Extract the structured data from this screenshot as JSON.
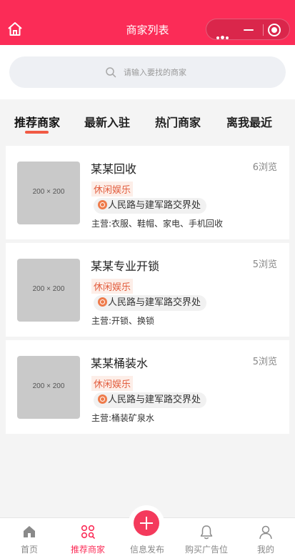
{
  "header": {
    "title": "商家列表",
    "home_icon": "home-icon",
    "capsule": {
      "more_icon": "more-dots-icon",
      "minimize_icon": "minimize-icon",
      "close_icon": "target-close-icon"
    }
  },
  "search": {
    "placeholder": "请输入要找的商家",
    "icon": "search-icon"
  },
  "tabs": [
    {
      "label": "推荐商家",
      "active": true
    },
    {
      "label": "最新入驻",
      "active": false
    },
    {
      "label": "热门商家",
      "active": false
    },
    {
      "label": "离我最近",
      "active": false
    }
  ],
  "merchants": [
    {
      "image_text": "200 × 200",
      "name": "某某回收",
      "views": "6浏览",
      "tag": "休闲娱乐",
      "address": "人民路与建军路交界处",
      "main": "主营:衣服、鞋帽、家电、手机回收"
    },
    {
      "image_text": "200 × 200",
      "name": "某某专业开锁",
      "views": "5浏览",
      "tag": "休闲娱乐",
      "address": "人民路与建军路交界处",
      "main": "主营:开锁、换锁"
    },
    {
      "image_text": "200 × 200",
      "name": "某某桶装水",
      "views": "5浏览",
      "tag": "休闲娱乐",
      "address": "人民路与建军路交界处",
      "main": "主营:桶装矿泉水"
    }
  ],
  "bottom_nav": [
    {
      "label": "首页",
      "icon": "home-icon",
      "active": false
    },
    {
      "label": "推荐商家",
      "icon": "merchants-icon",
      "active": true
    },
    {
      "label": "信息发布",
      "icon": "plus-icon",
      "active": false
    },
    {
      "label": "购买广告位",
      "icon": "bell-icon",
      "active": false
    },
    {
      "label": "我的",
      "icon": "user-icon",
      "active": false
    }
  ],
  "colors": {
    "brand": "#fb2c57",
    "tag_text": "#e25d3e",
    "tab_underline": "#f15a44"
  }
}
